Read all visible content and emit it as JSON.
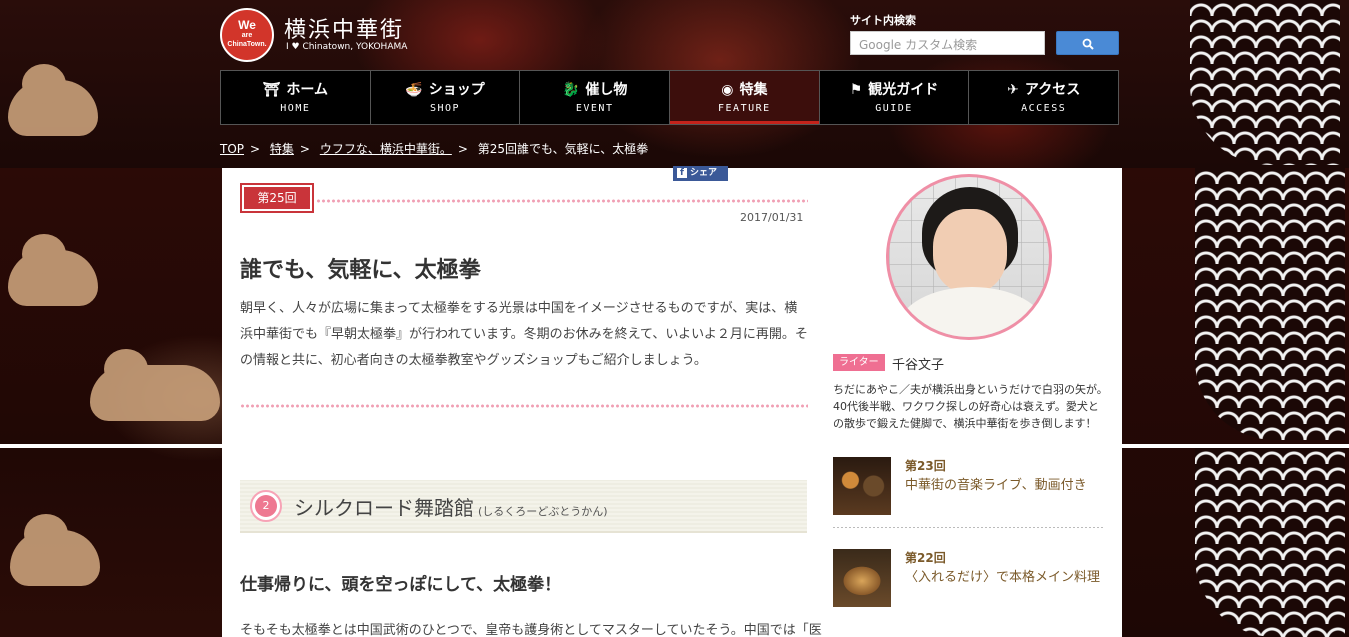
{
  "header": {
    "logo_line1": "We",
    "logo_line2": "are",
    "logo_line3": "ChinaTown.",
    "site_title": "横浜中華街",
    "site_sub": "I ♥ Chinatown, YOKOHAMA",
    "search_label": "サイト内検索",
    "search_placeholder": "Google カスタム検索",
    "search_button_icon": "search-icon"
  },
  "nav": {
    "items": [
      {
        "jp": "ホーム",
        "en": "HOME",
        "icon": "⛩"
      },
      {
        "jp": "ショップ",
        "en": "SHOP",
        "icon": "🍜"
      },
      {
        "jp": "催し物",
        "en": "EVENT",
        "icon": "🐉"
      },
      {
        "jp": "特集",
        "en": "FEATURE",
        "icon": "◉"
      },
      {
        "jp": "観光ガイド",
        "en": "GUIDE",
        "icon": "⚑"
      },
      {
        "jp": "アクセス",
        "en": "ACCESS",
        "icon": "✈"
      }
    ],
    "active_index": 3
  },
  "breadcrumb": {
    "items": [
      "TOP",
      "特集",
      "ウフフな、横浜中華街。"
    ],
    "current": "第25回誰でも、気軽に、太極拳",
    "separator": ">"
  },
  "article": {
    "share_label": "シェア",
    "issue": "第25回",
    "date": "2017/01/31",
    "title": "誰でも、気軽に、太極拳",
    "lead": "朝早く、人々が広場に集まって太極拳をする光景は中国をイメージさせるものですが、実は、横浜中華街でも『早朝太極拳』が行われています。冬期のお休みを終えて、いよいよ２月に再開。その情報と共に、初心者向きの太極拳教室やグッズショップもご紹介しましょう。",
    "section_number": "2",
    "section_title": "シルクロード舞踏館",
    "section_reading": "(しるくろーどぶとうかん)",
    "subhead": "仕事帰りに、頭を空っぽにして、太極拳！",
    "body_start": "そもそも太極拳とは中国武術のひとつで、皇帝も護身術としてマスターしていたそう。中国では「医"
  },
  "sidebar": {
    "writer_tag": "ライター",
    "writer_name": "千谷文子",
    "writer_bio": "ちだにあやこ／夫が横浜出身というだけで白羽の矢が。40代後半戦、ワクワク探しの好奇心は衰えず。愛犬との散歩で鍛えた健脚で、横浜中華街を歩き倒します！",
    "related": [
      {
        "no": "第23回",
        "title": "中華街の音楽ライブ、動画付き"
      },
      {
        "no": "第22回",
        "title": "〈入れるだけ〉で本格メイン料理"
      }
    ]
  },
  "colors": {
    "accent_red": "#c9343a",
    "pink": "#ef6f92",
    "nav_bg": "#000000",
    "search_btn": "#4a8ad6"
  }
}
